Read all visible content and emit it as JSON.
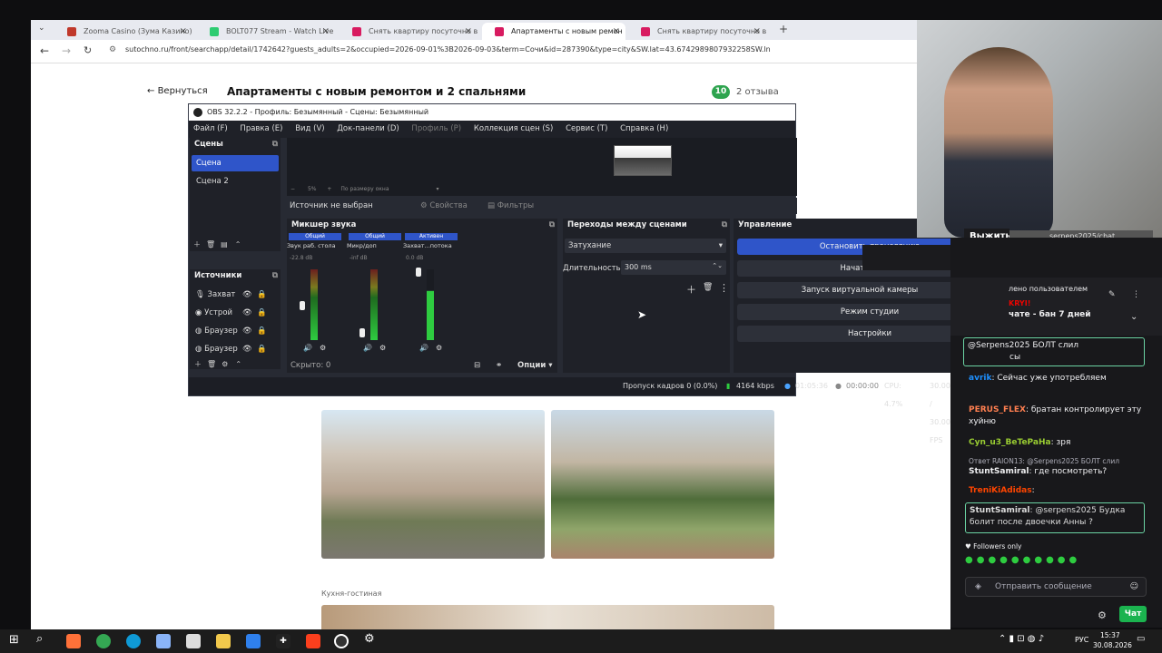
{
  "browser": {
    "tabs": [
      {
        "label": "Zooma Casino (Зума Казино) о",
        "color": "#c0392b"
      },
      {
        "label": "BOLT077 Stream - Watch Live o",
        "color": "#2ecc71"
      },
      {
        "label": "Снять квартиру посуточно в С",
        "color": "#d81b60"
      },
      {
        "label": "Апартаменты с новым ремон",
        "color": "#d81b60"
      },
      {
        "label": "Снять квартиру посуточно в Э",
        "color": "#d81b60"
      }
    ],
    "url": "sutochno.ru/front/searchapp/detail/1742642?guests_adults=2&occupied=2026-09-01%3B2026-09-03&term=Сочи&id=287390&type=city&SW.lat=43.6742989807932258SW.ln",
    "back_label": "Вернуться",
    "page_title": "Апартаменты с новым ремонтом и 2 спальнями",
    "rating": "10",
    "reviews": "2 отзыва",
    "caption": "Кухня-гостиная"
  },
  "obs": {
    "title": "OBS 32.2.2 - Профиль: Безымянный - Сцены: Безымянный",
    "menu": [
      "Файл (F)",
      "Правка (E)",
      "Вид (V)",
      "Док-панели (D)",
      "Профиль (P)",
      "Коллекция сцен (S)",
      "Сервис (T)",
      "Справка (H)"
    ],
    "zoom": "5%",
    "fit": "По размеру окна",
    "no_source": "Источник не выбран",
    "props": "Свойства",
    "filters": "Фильтры",
    "scenes_title": "Сцены",
    "scenes": [
      "Сцена",
      "Сцена 2"
    ],
    "sources_title": "Источники",
    "sources": [
      "Захват",
      "Устрой",
      "Браузер",
      "Браузер"
    ],
    "mixer_title": "Микшер звука",
    "mixer_channels": [
      {
        "tag": "Общий",
        "name": "Звук раб. стола",
        "db": "-22.8 dB"
      },
      {
        "tag": "Общий",
        "name": "Микр/доп",
        "db": "-inf dB"
      },
      {
        "tag": "Активен",
        "name": "Захват...потока",
        "db": "0.0 dB"
      }
    ],
    "hidden": "Скрыто: 0",
    "options": "Опции",
    "transitions_title": "Переходы между сценами",
    "transition": "Затухание",
    "duration_label": "Длительность",
    "duration": "300 ms",
    "control_title": "Управление",
    "control_buttons": [
      "Остановить трансляцию",
      "Начать запись",
      "Запуск виртуальной камеры",
      "Режим студии",
      "Настройки"
    ],
    "status": {
      "dropped": "Пропуск кадров 0 (0.0%)",
      "bitrate": "4164 kbps",
      "stream_time": "01:05:36",
      "rec_time": "00:00:00",
      "cpu": "CPU: 4.7%",
      "fps": "30.00 / 30.00 FPS"
    }
  },
  "overlay": {
    "vyzhit": "Выжить",
    "chat_url": "serpens2025/chat",
    "donation": "0 RUB (0%)"
  },
  "chat": {
    "pinned_line1": "лено пользователем",
    "pinned_line2": "KRYI!",
    "pinned_line3": "чате - бан 7 дней",
    "messages": [
      {
        "user": "",
        "text": "@Serpens2025 БОЛТ слил",
        "color": "#efeff1"
      },
      {
        "user": "",
        "text": "сы",
        "color": "#efeff1"
      },
      {
        "user": "avrik",
        "text": ": Сейчас уже употребляем",
        "color": "#1e90ff"
      },
      {
        "user": "PERUS_FLEX",
        "text": ": братан контролирует эту хуйню",
        "color": "#ff7f50"
      },
      {
        "user": "Cyn_u3_BeTePaHa",
        "text": ": зря",
        "color": "#9acd32"
      },
      {
        "user": "",
        "text": "Ответ RAION13: @Serpens2025 БОЛТ слил",
        "color": "#adadb8"
      },
      {
        "user": "StuntSamiral",
        "text": ": где посмотреть?",
        "color": "#efeff1"
      },
      {
        "user": "TreniKiAdidas",
        "text": ":",
        "color": "#ff4500"
      },
      {
        "user": "StuntSamiral",
        "text": ": @serpens2025 Будка болит после двоечки Анны ?",
        "color": "#efeff1"
      }
    ],
    "followers_only": "Followers only",
    "send_placeholder": "Отправить сообщение",
    "chat_button": "Чат"
  },
  "taskbar": {
    "lang": "РУС",
    "time": "15:37",
    "date": "30.08.2026"
  }
}
